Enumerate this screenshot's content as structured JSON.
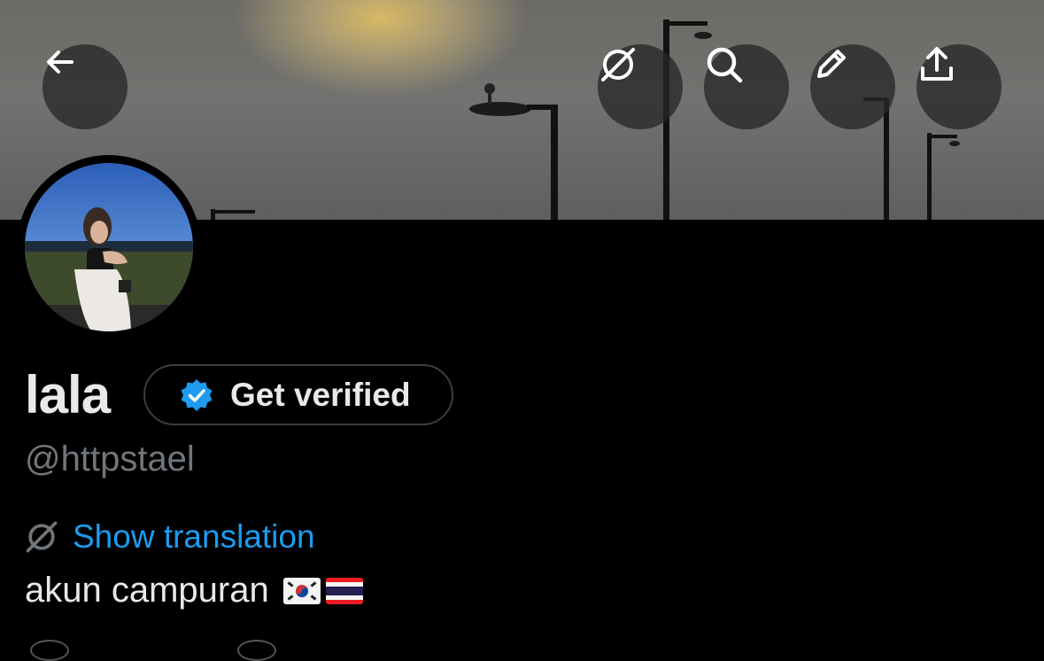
{
  "profile": {
    "display_name": "lala",
    "get_verified_label": "Get verified",
    "handle": "@httpstael",
    "show_translation_label": "Show translation",
    "bio_text": "akun campuran"
  },
  "icons": {
    "back": "arrow-left-icon",
    "translate": "translate-icon",
    "search": "search-icon",
    "edit": "pencil-icon",
    "share": "share-icon",
    "verified": "verified-badge-icon",
    "flags": [
      "south-korea-flag",
      "thailand-flag"
    ]
  },
  "colors": {
    "accent": "#1d9bf0",
    "background": "#000000",
    "muted_text": "#71767b",
    "primary_text": "#e7e9ea"
  }
}
